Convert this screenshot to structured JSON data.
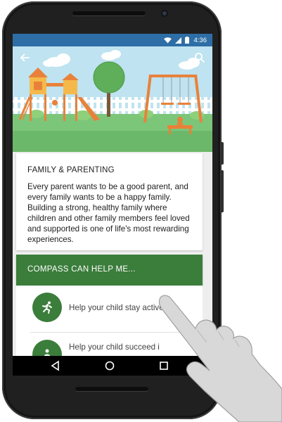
{
  "status_bar": {
    "time": "4:36",
    "icons": [
      "wifi-icon",
      "signal-icon",
      "battery-icon"
    ],
    "color": "#2e6ea6"
  },
  "app_bar": {
    "back_icon": "back-arrow-icon",
    "search_icon": "search-icon"
  },
  "hero": {
    "illustration": "playground-illustration",
    "sky_color": "#bfe3f0",
    "grass_color": "#7cc67a"
  },
  "family_card": {
    "title": "FAMILY & PARENTING",
    "body": "Every parent wants to be a good parent, and every family wants to be a happy family. Building a strong, healthy family where children and other family members feel loved and supported is one of life's most rewarding experiences."
  },
  "help_section": {
    "header": "COMPASS CAN HELP ME...",
    "color": "#3b7d3b",
    "items": [
      {
        "label": "Help your child stay active",
        "icon": "running-icon"
      },
      {
        "label": "Help your child succeed i",
        "icon": "person-icon"
      }
    ]
  },
  "nav_bar": {
    "buttons": [
      "back-triangle-icon",
      "home-circle-icon",
      "recents-square-icon"
    ]
  }
}
